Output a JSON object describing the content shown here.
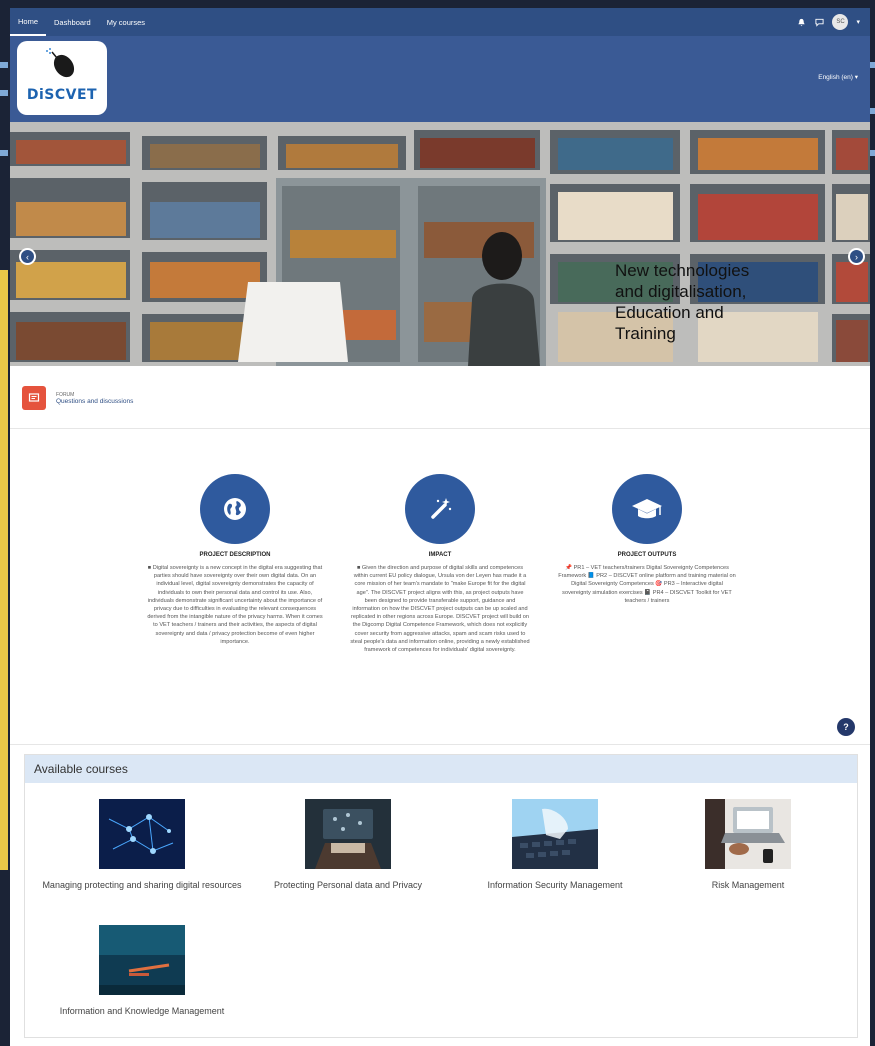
{
  "navbar": {
    "items": [
      {
        "label": "Home",
        "active": true
      },
      {
        "label": "Dashboard",
        "active": false
      },
      {
        "label": "My courses",
        "active": false
      }
    ],
    "user_initials": "SC",
    "icons": [
      "bell-icon",
      "chat-icon"
    ]
  },
  "header": {
    "logo_text": "DiSCVET",
    "language": "English (en) ▾"
  },
  "hero": {
    "caption_lines": [
      "New technologies",
      "and digitalisation,",
      "Education and",
      "Training"
    ]
  },
  "forum": {
    "type_label": "FORUM",
    "name": "Questions and discussions"
  },
  "project": [
    {
      "icon": "globe-icon",
      "title": "PROJECT DESCRIPTION",
      "text": "■ Digital sovereignty is a new concept in the digital era suggesting that parties should have sovereignty over their own digital data. On an individual level, digital sovereignty demonstrates the capacity of individuals to own their personal data and control its use. Also, individuals demonstrate significant uncertainty about the importance of privacy due to difficulties in evaluating the relevant consequences derived from the intangible nature of the privacy harms. When it comes to VET teachers / trainers and their activities, the aspects of digital sovereignty and data / privacy protection become of even higher importance."
    },
    {
      "icon": "magic-wand-icon",
      "title": "IMPACT",
      "text": "■ Given the direction and purpose of digital skills and competences within current EU policy dialogue, Ursula von der Leyen has made it a core mission of her team's mandate to \"make Europe fit for the digital age\". The DISCVET project aligns with this, as project outputs have been designed to provide transferable support, guidance and information on how the DISCVET project outputs can be up scaled and replicated in other regions across Europe. DISCVET project will build on the Digcomp Digital Competence Framework, which does not explicitly cover security from aggressive attacks, spam and scam risks used to steal people's data and information online, providing a newly established framework of competences for individuals' digital sovereignty."
    },
    {
      "icon": "graduation-cap-icon",
      "title": "PROJECT OUTPUTS",
      "text": "📌 PR1 – VET teachers/trainers Digital Sovereignty Competences Framework 📘 PR2 – DISCVET online platform and training material on Digital Sovereignty Competences 🎯 PR3 – Interactive digital sovereignty simulation exercises 📓 PR4 – DISCVET Toolkit for VET teachers / trainers"
    }
  ],
  "help_label": "?",
  "courses": {
    "heading": "Available courses",
    "items": [
      {
        "title": "Managing protecting and sharing digital resources"
      },
      {
        "title": "Protecting Personal data and Privacy"
      },
      {
        "title": "Information Security Management"
      },
      {
        "title": "Risk Management"
      },
      {
        "title": "Information and Knowledge Management"
      }
    ]
  },
  "colors": {
    "navbar": "#2f4f84",
    "header": "#3a5a95",
    "accent_circle": "#2f5a9e",
    "forum_icon": "#e5533d",
    "courses_head": "#dbe7f5"
  }
}
